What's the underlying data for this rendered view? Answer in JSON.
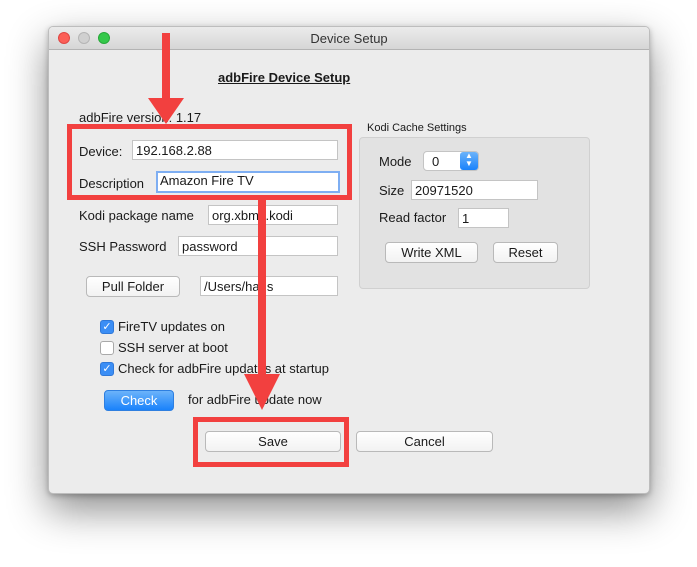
{
  "window": {
    "title": "Device Setup"
  },
  "header": {
    "title": "adbFire Device Setup",
    "version": "adbFire version: 1.17"
  },
  "device": {
    "device_label": "Device:",
    "device_value": "192.168.2.88",
    "description_label": "Description",
    "description_value": "Amazon Fire TV",
    "package_label": "Kodi package name",
    "package_value": "org.xbmc.kodi",
    "ssh_label": "SSH Password",
    "ssh_value": "password",
    "pull_folder_label": "Pull Folder",
    "pull_folder_value": "/Users/hans"
  },
  "options": {
    "firetv_updates": "FireTV updates on",
    "ssh_server": "SSH server at boot",
    "check_updates": "Check for adbFire updates at startup",
    "check_button": "Check",
    "check_text": "for adbFire update now"
  },
  "cache": {
    "title": "Kodi Cache Settings",
    "mode_label": "Mode",
    "mode_value": "0",
    "size_label": "Size",
    "size_value": "20971520",
    "read_factor_label": "Read factor",
    "read_factor_value": "1",
    "write_xml": "Write XML",
    "reset": "Reset"
  },
  "footer": {
    "save": "Save",
    "cancel": "Cancel"
  },
  "colors": {
    "annotation": "#f2403f",
    "accent": "#1a82fb",
    "checkbox": "#3b8ef5"
  }
}
